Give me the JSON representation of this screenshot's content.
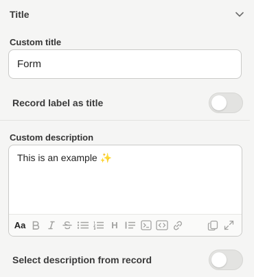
{
  "section": {
    "title": "Title"
  },
  "custom_title": {
    "label": "Custom title",
    "value": "Form"
  },
  "record_label_toggle": {
    "label": "Record label as title",
    "on": false
  },
  "custom_description": {
    "label": "Custom description",
    "value": "This is an example",
    "emoji": "✨",
    "toolbar": {
      "text_style": "Aa",
      "heading": "H",
      "icons": [
        "bold-icon",
        "italic-icon",
        "strikethrough-icon",
        "bullet-list-icon",
        "numbered-list-icon",
        "heading-icon",
        "quote-icon",
        "code-block-icon",
        "embed-icon",
        "link-icon",
        "copy-icon",
        "expand-icon"
      ]
    }
  },
  "select_description_toggle": {
    "label": "Select description from record",
    "on": false
  }
}
